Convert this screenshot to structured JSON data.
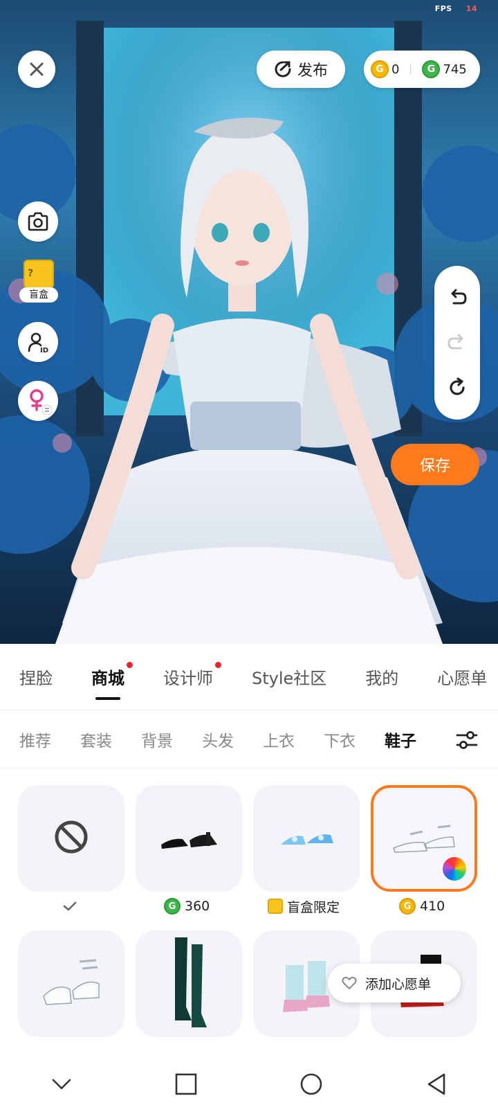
{
  "status": {
    "fps_label": "FPS",
    "fps_value": "14"
  },
  "top": {
    "publish_label": "发布",
    "gold_balance": "0",
    "green_balance": "745",
    "gold_coin_glyph": "G",
    "green_coin_glyph": "G"
  },
  "side": {
    "blindbox_label": "盲盒",
    "blindbox_mark": "?"
  },
  "save_label": "保存",
  "main_tabs": [
    {
      "label": "捏脸",
      "active": false,
      "dot": false
    },
    {
      "label": "商城",
      "active": true,
      "dot": true
    },
    {
      "label": "设计师",
      "active": false,
      "dot": true
    },
    {
      "label": "Style社区",
      "active": false,
      "dot": false
    },
    {
      "label": "我的",
      "active": false,
      "dot": false
    },
    {
      "label": "心愿单",
      "active": false,
      "dot": false
    }
  ],
  "sub_tabs": [
    {
      "label": "推荐",
      "active": false
    },
    {
      "label": "套装",
      "active": false
    },
    {
      "label": "背景",
      "active": false
    },
    {
      "label": "头发",
      "active": false
    },
    {
      "label": "上衣",
      "active": false
    },
    {
      "label": "下衣",
      "active": false
    },
    {
      "label": "鞋子",
      "active": true
    }
  ],
  "items": [
    {
      "name": "none",
      "price": "",
      "price_type": "check",
      "selected": false
    },
    {
      "name": "black-shoes",
      "price": "360",
      "price_type": "green",
      "selected": false
    },
    {
      "name": "blue-crystal-heels",
      "price": "盲盒限定",
      "price_type": "blindbox",
      "selected": false
    },
    {
      "name": "white-strap-shoes",
      "price": "410",
      "price_type": "gold",
      "selected": true
    },
    {
      "name": "white-strap-heels",
      "price": "",
      "price_type": "gold",
      "selected": false
    },
    {
      "name": "green-boots",
      "price": "",
      "price_type": "blindbox",
      "selected": false
    },
    {
      "name": "pink-boots",
      "price": "",
      "price_type": "gold",
      "selected": false
    },
    {
      "name": "red-black-shoes",
      "price": "",
      "price_type": "gold",
      "selected": false
    }
  ],
  "wish_tip_label": "添加心愿单",
  "colors": {
    "accent": "#ff7a1a",
    "red_dot": "#e8262b",
    "gold": "#f5b700",
    "green": "#3db54a"
  }
}
